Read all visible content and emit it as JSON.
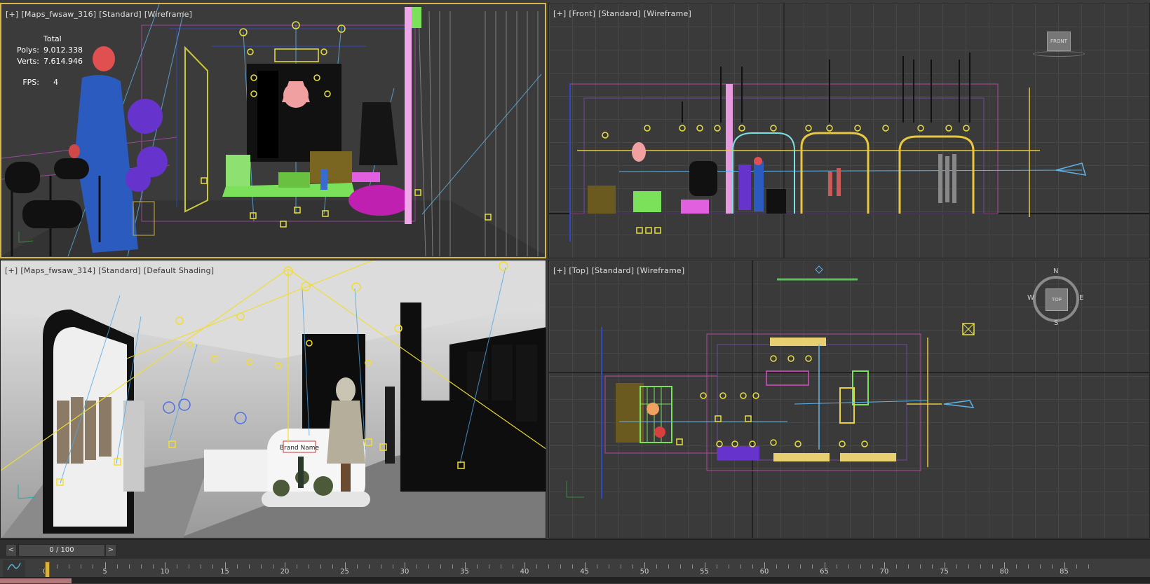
{
  "viewports": {
    "perspective": {
      "label_plus": "[+]",
      "label_name": "[Maps_fwsaw_316]",
      "label_mode": "[Standard]",
      "label_shading": "[Wireframe]",
      "stats": {
        "total_label": "Total",
        "polys_label": "Polys:",
        "polys_value": "9.012.338",
        "verts_label": "Verts:",
        "verts_value": "7.614.946",
        "fps_label": "FPS:",
        "fps_value": "4"
      }
    },
    "front": {
      "label_plus": "[+]",
      "label_name": "[Front]",
      "label_mode": "[Standard]",
      "label_shading": "[Wireframe]",
      "viewcube_label": "FRONT"
    },
    "camera": {
      "label_plus": "[+]",
      "label_name": "[Maps_fwsaw_314]",
      "label_mode": "[Standard]",
      "label_shading": "[Default Shading]",
      "sign_text": "Brand Name"
    },
    "top": {
      "label_plus": "[+]",
      "label_name": "[Top]",
      "label_mode": "[Standard]",
      "label_shading": "[Wireframe]",
      "viewcube_label": "TOP",
      "compass": {
        "n": "N",
        "s": "S",
        "e": "E",
        "w": "W"
      }
    }
  },
  "timeline": {
    "prev_label": "<",
    "next_label": ">",
    "frame_display": "0 / 100",
    "current_frame": 0,
    "total_frames": 100,
    "tick_labels": [
      "0",
      "5",
      "10",
      "15",
      "20",
      "25",
      "30",
      "35",
      "40",
      "45",
      "50",
      "55",
      "60",
      "65",
      "70",
      "75",
      "80",
      "85"
    ],
    "curve_icon": "curve-editor-icon"
  },
  "colors": {
    "active_border": "#d7b64a",
    "grid": "#474747",
    "viewport_bg": "#3a3a3a"
  }
}
